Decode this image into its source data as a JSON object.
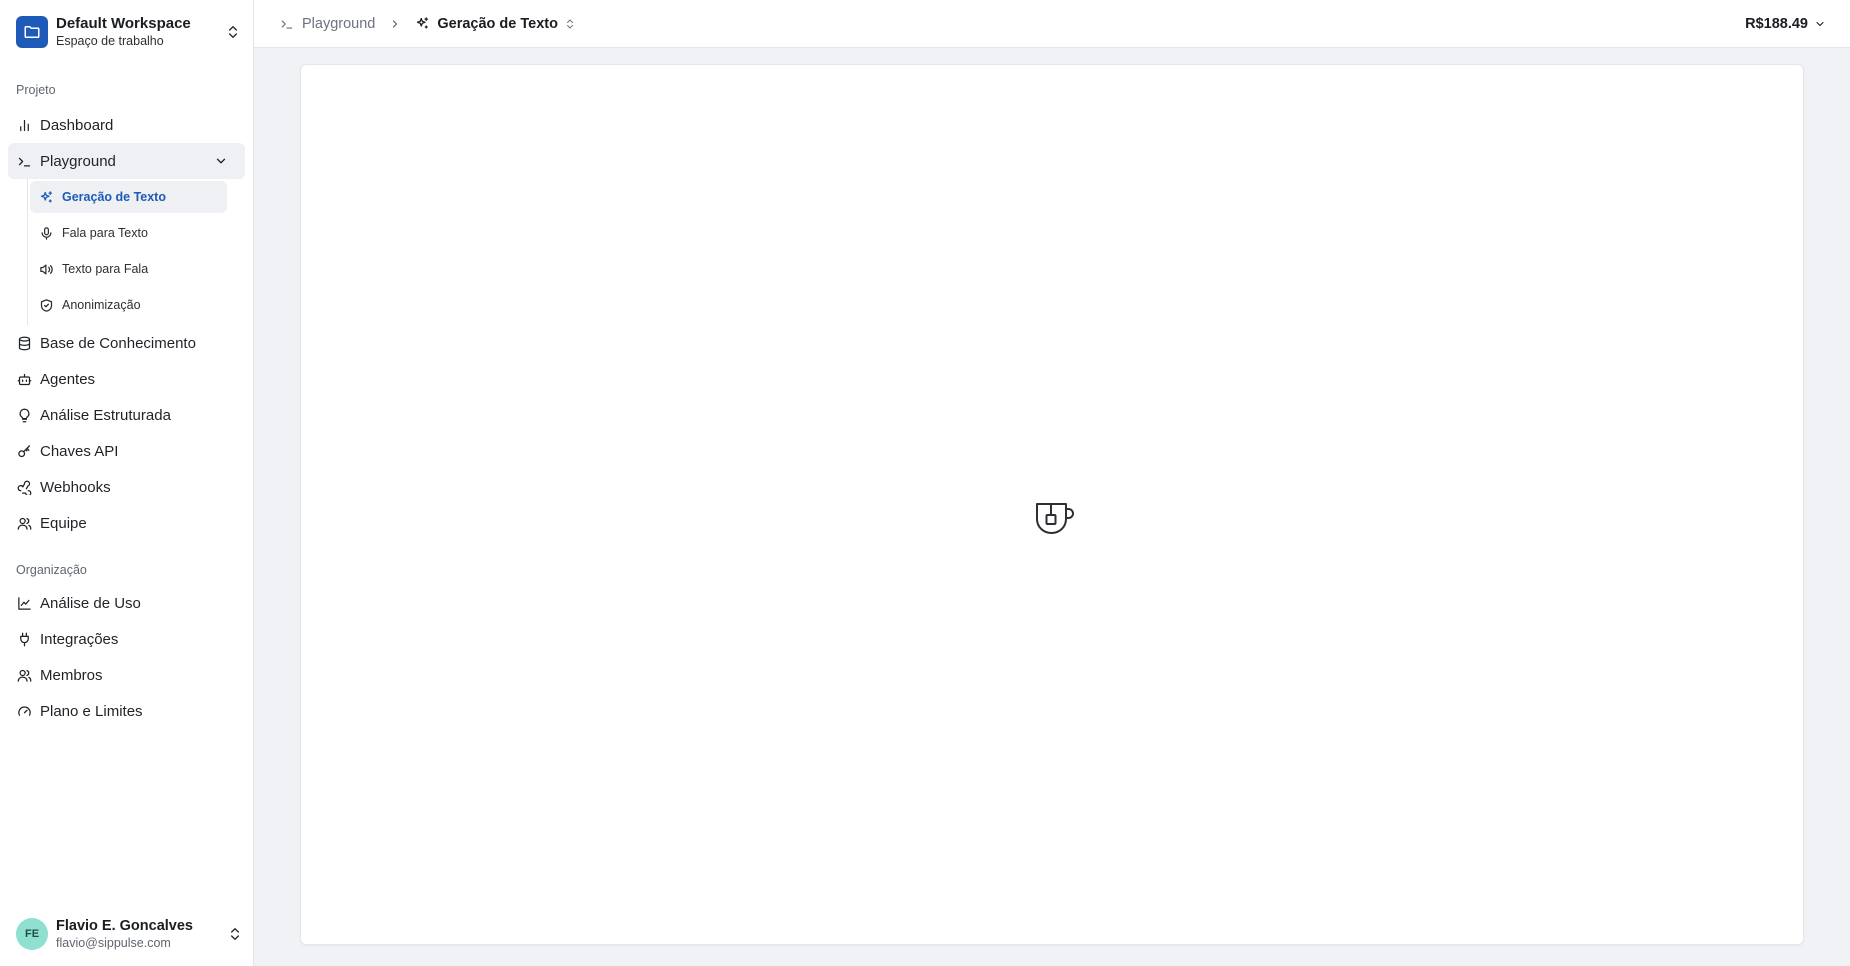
{
  "workspace": {
    "name": "Default Workspace",
    "subtitle": "Espaço de trabalho",
    "icon": "folder-icon"
  },
  "sidebar": {
    "project_label": "Projeto",
    "items": [
      {
        "label": "Dashboard",
        "icon": "bar-chart-icon"
      },
      {
        "label": "Playground",
        "icon": "terminal-icon",
        "expanded": true
      },
      {
        "label": "Base de Conhecimento",
        "icon": "database-icon"
      },
      {
        "label": "Agentes",
        "icon": "bot-icon"
      },
      {
        "label": "Análise Estruturada",
        "icon": "lightbulb-icon"
      },
      {
        "label": "Chaves API",
        "icon": "key-icon"
      },
      {
        "label": "Webhooks",
        "icon": "webhook-icon"
      },
      {
        "label": "Equipe",
        "icon": "users-icon"
      }
    ],
    "playground_sub": [
      {
        "label": "Geração de Texto",
        "icon": "sparkles-icon",
        "active": true
      },
      {
        "label": "Fala para Texto",
        "icon": "mic-icon"
      },
      {
        "label": "Texto para Fala",
        "icon": "speaker-icon"
      },
      {
        "label": "Anonimização",
        "icon": "shield-check-icon"
      }
    ],
    "org_label": "Organização",
    "org_items": [
      {
        "label": "Análise de Uso",
        "icon": "line-chart-icon"
      },
      {
        "label": "Integrações",
        "icon": "plug-icon"
      },
      {
        "label": "Membros",
        "icon": "members-icon"
      },
      {
        "label": "Plano e Limites",
        "icon": "gauge-icon"
      }
    ]
  },
  "user": {
    "initials": "FE",
    "name": "Flavio E. Goncalves",
    "email": "flavio@sippulse.com"
  },
  "header": {
    "breadcrumb_parent": "Playground",
    "breadcrumb_current": "Geração de Texto",
    "balance": "R$188.49"
  },
  "main": {
    "loading_icon": "teacup-icon"
  },
  "colors": {
    "accent": "#1e5bb8",
    "avatar_bg": "#8fe0d0",
    "active_bg": "#eef0f3"
  }
}
